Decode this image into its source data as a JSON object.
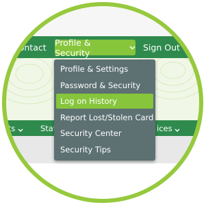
{
  "top_nav": {
    "contact_label": "Contact",
    "profile_security_label": "Profile & Security",
    "sign_out_label": "Sign Out"
  },
  "dropdown": {
    "items": [
      {
        "label": "Profile & Settings",
        "active": false
      },
      {
        "label": "Password & Security",
        "active": false
      },
      {
        "label": "Log on History",
        "active": true
      },
      {
        "label": "Report Lost/Stolen Card",
        "active": false
      },
      {
        "label": "Security Center",
        "active": false
      },
      {
        "label": "Security Tips",
        "active": false
      }
    ]
  },
  "sub_nav": {
    "item1_label": "rts",
    "item2_label": "Stat",
    "item3_label": "ices"
  },
  "colors": {
    "nav_green": "#2f8a4d",
    "accent_green": "#86c53c",
    "frame_green": "#96c93d",
    "dropdown_gray": "#5d7072"
  },
  "icons": {
    "chevron": "chevron-down-icon"
  }
}
